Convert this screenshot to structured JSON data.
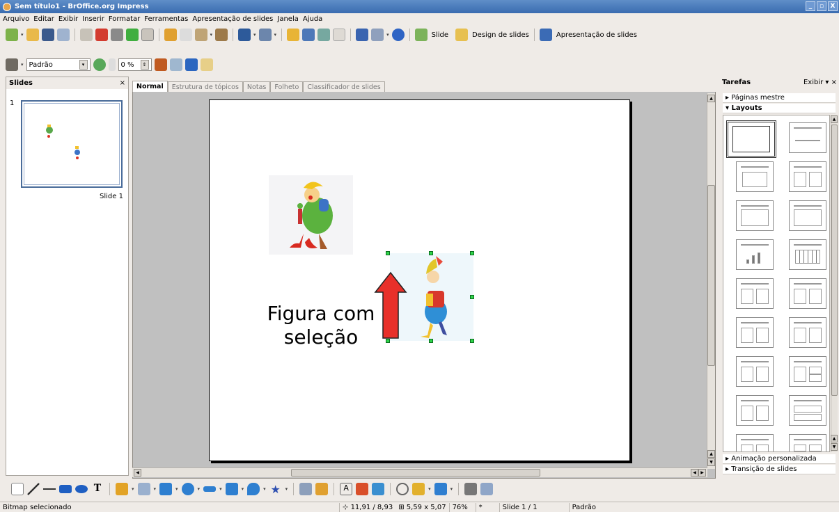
{
  "window": {
    "title": "Sem título1 - BrOffice.org Impress"
  },
  "menu": [
    "Arquivo",
    "Editar",
    "Exibir",
    "Inserir",
    "Formatar",
    "Ferramentas",
    "Apresentação de slides",
    "Janela",
    "Ajuda"
  ],
  "toolbar": {
    "slide_label": "Slide",
    "design_label": "Design de slides",
    "presentation_label": "Apresentação de slides"
  },
  "line_toolbar": {
    "style_value": "Padrão",
    "transparency_value": "0 %"
  },
  "slides_panel": {
    "title": "Slides",
    "close": "×",
    "slide_number": "1",
    "slide_caption": "Slide 1"
  },
  "view_tabs": [
    "Normal",
    "Estrutura de tópicos",
    "Notas",
    "Folheto",
    "Classificador de slides"
  ],
  "slide": {
    "annotation_line1": "Figura com",
    "annotation_line2": "seleção"
  },
  "tasks": {
    "title": "Tarefas",
    "view_menu": "Exibir",
    "close": "×",
    "sections": {
      "master_pages": "Páginas mestre",
      "layouts": "Layouts",
      "custom_animation": "Animação personalizada",
      "slide_transition": "Transição de slides"
    }
  },
  "statusbar": {
    "status": "Bitmap selecionado",
    "position": "11,91 / 8,93",
    "size": "5,59 x 5,07",
    "zoom": "76%",
    "modified": "*",
    "slide_pos": "Slide 1 / 1",
    "layout": "Padrão"
  },
  "colors": {
    "titlebar": "#3a6cb0",
    "handles": "#2fd44a",
    "arrow_fill": "#e8302a",
    "selection_border": "#4a6c9a"
  }
}
